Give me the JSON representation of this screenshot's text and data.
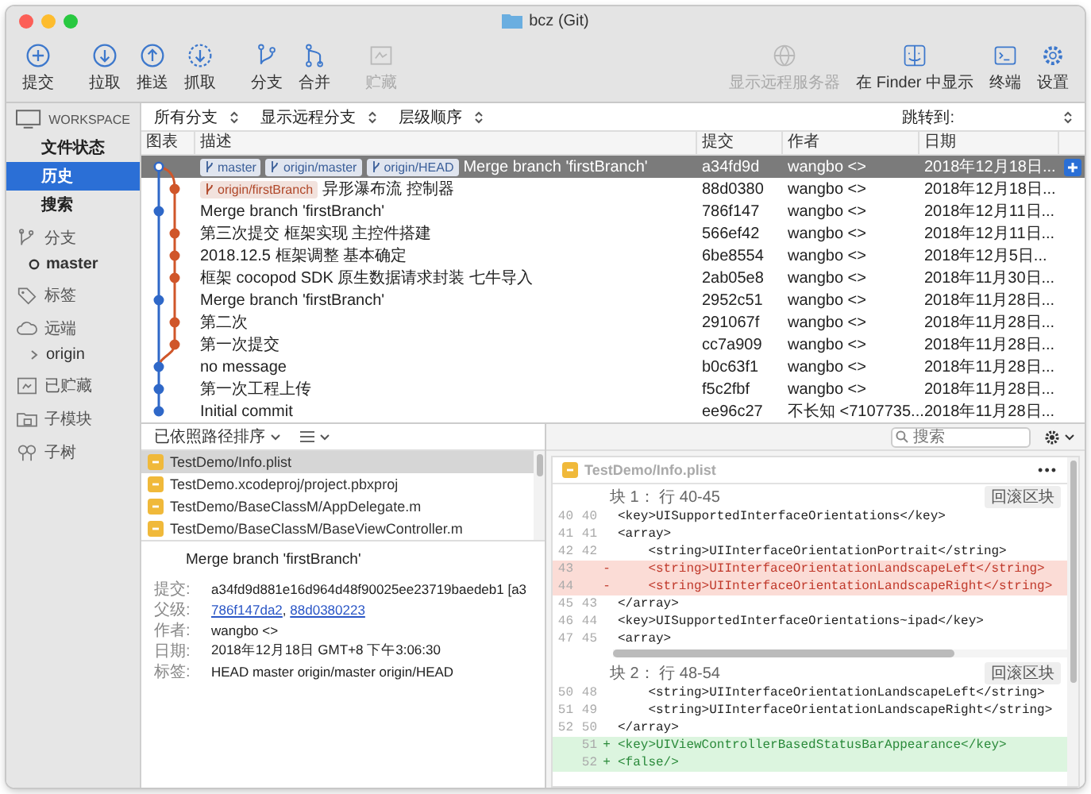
{
  "window": {
    "title": "bcz (Git)"
  },
  "toolbar": {
    "groups": [
      [
        {
          "label": "提交",
          "disabled": false
        }
      ],
      [
        {
          "label": "拉取",
          "disabled": false
        },
        {
          "label": "推送",
          "disabled": false
        },
        {
          "label": "抓取",
          "disabled": false
        }
      ],
      [
        {
          "label": "分支",
          "disabled": false
        },
        {
          "label": "合并",
          "disabled": false
        }
      ],
      [
        {
          "label": "贮藏",
          "disabled": true
        }
      ]
    ],
    "right": [
      {
        "label": "显示远程服务器",
        "disabled": true
      },
      {
        "label": "在 Finder 中显示",
        "disabled": false
      },
      {
        "label": "终端",
        "disabled": false
      },
      {
        "label": "设置",
        "disabled": false
      }
    ]
  },
  "sidebar": {
    "workspace_label": "WORKSPACE",
    "views": [
      {
        "label": "文件状态",
        "selected": false
      },
      {
        "label": "历史",
        "selected": true
      },
      {
        "label": "搜索",
        "selected": false
      }
    ],
    "sections": [
      {
        "label": "分支",
        "children": [
          {
            "label": "master",
            "kind": "branch",
            "current": true
          }
        ]
      },
      {
        "label": "标签"
      },
      {
        "label": "远端",
        "children": [
          {
            "label": "origin",
            "kind": "remote",
            "current": false
          }
        ]
      },
      {
        "label": "已贮藏"
      },
      {
        "label": "子模块"
      },
      {
        "label": "子树"
      }
    ]
  },
  "filters": {
    "selects": [
      "所有分支",
      "显示远程分支",
      "层级顺序"
    ],
    "jump_label": "跳转到:"
  },
  "table": {
    "columns": [
      "图表",
      "描述",
      "提交",
      "作者",
      "日期"
    ],
    "rows": [
      {
        "refs": [
          {
            "name": "master",
            "color": "#3b5f99"
          },
          {
            "name": "origin/master",
            "color": "#3b5f99"
          },
          {
            "name": "origin/HEAD",
            "color": "#3b5f99"
          }
        ],
        "message": "Merge branch 'firstBranch'",
        "hash": "a34fd9d",
        "author": "wangbo <>",
        "date": "2018年12月18日...",
        "color": "#2f68c8",
        "current": true,
        "selected": true
      },
      {
        "refs": [
          {
            "name": "origin/firstBranch",
            "color": "#b0482a"
          }
        ],
        "message": "异形瀑布流  控制器",
        "hash": "88d0380",
        "author": "wangbo <>",
        "date": "2018年12月18日...",
        "color": "#d0562a",
        "current": false,
        "selected": false
      },
      {
        "refs": [],
        "message": "Merge branch 'firstBranch'",
        "hash": "786f147",
        "author": "wangbo <>",
        "date": "2018年12月11日...",
        "color": "#2f68c8",
        "current": false,
        "selected": false
      },
      {
        "refs": [],
        "message": "第三次提交  框架实现  主控件搭建",
        "hash": "566ef42",
        "author": "wangbo <>",
        "date": "2018年12月11日...",
        "color": "#d0562a",
        "current": false,
        "selected": false
      },
      {
        "refs": [],
        "message": "2018.12.5  框架调整  基本确定",
        "hash": "6be8554",
        "author": "wangbo <>",
        "date": "2018年12月5日...",
        "color": "#d0562a",
        "current": false,
        "selected": false
      },
      {
        "refs": [],
        "message": "框架  cocopod   SDK  原生数据请求封装  七牛导入",
        "hash": "2ab05e8",
        "author": "wangbo <>",
        "date": "2018年11月30日...",
        "color": "#d0562a",
        "current": false,
        "selected": false
      },
      {
        "refs": [],
        "message": "Merge branch 'firstBranch'",
        "hash": "2952c51",
        "author": "wangbo <>",
        "date": "2018年11月28日...",
        "color": "#2f68c8",
        "current": false,
        "selected": false
      },
      {
        "refs": [],
        "message": "第二次",
        "hash": "291067f",
        "author": "wangbo <>",
        "date": "2018年11月28日...",
        "color": "#d0562a",
        "current": false,
        "selected": false
      },
      {
        "refs": [],
        "message": "第一次提交",
        "hash": "cc7a909",
        "author": "wangbo <>",
        "date": "2018年11月28日...",
        "color": "#d0562a",
        "current": false,
        "selected": false
      },
      {
        "refs": [],
        "message": "no message",
        "hash": "b0c63f1",
        "author": "wangbo <>",
        "date": "2018年11月28日...",
        "color": "#2f68c8",
        "current": false,
        "selected": false
      },
      {
        "refs": [],
        "message": "第一次工程上传",
        "hash": "f5c2fbf",
        "author": "wangbo <>",
        "date": "2018年11月28日...",
        "color": "#2f68c8",
        "current": false,
        "selected": false
      },
      {
        "refs": [],
        "message": "Initial commit",
        "hash": "ee96c27",
        "author": "不长知 <7107735...",
        "date": "2018年11月28日...",
        "color": "#2f68c8",
        "current": false,
        "selected": false
      }
    ]
  },
  "files": {
    "sort_label": "已依照路径排序",
    "items": [
      {
        "path": "TestDemo/Info.plist",
        "selected": true
      },
      {
        "path": "TestDemo.xcodeproj/project.pbxproj",
        "selected": false
      },
      {
        "path": "TestDemo/BaseClassM/AppDelegate.m",
        "selected": false
      },
      {
        "path": "TestDemo/BaseClassM/BaseViewController.m",
        "selected": false
      }
    ]
  },
  "commit_detail": {
    "message": "Merge branch 'firstBranch'",
    "fields": [
      {
        "label": "提交:",
        "kind": "text",
        "value": "a34fd9d881e16d964d48f90025ee23719baedeb1 [a3"
      },
      {
        "label": "父级:",
        "kind": "links",
        "links": [
          "786f147da2",
          "88d0380223"
        ],
        "separator": ", "
      },
      {
        "label": "作者:",
        "kind": "text",
        "value": "wangbo <>"
      },
      {
        "label": "日期:",
        "kind": "text",
        "value": "2018年12月18日 GMT+8 下午3:06:30"
      },
      {
        "label": "标签:",
        "kind": "text",
        "value": "HEAD master origin/master origin/HEAD"
      }
    ]
  },
  "diff": {
    "search_placeholder": "搜索",
    "file": "TestDemo/Info.plist",
    "more": "•••",
    "hunks": [
      {
        "title": "块 1： 行 40-45",
        "action": "回滚区块",
        "lines": [
          {
            "old": "40",
            "new": "40",
            "kind": "context",
            "text": "<key>UISupportedInterfaceOrientations</key>"
          },
          {
            "old": "41",
            "new": "41",
            "kind": "context",
            "text": "<array>"
          },
          {
            "old": "42",
            "new": "42",
            "kind": "context",
            "text": "    <string>UIInterfaceOrientationPortrait</string>"
          },
          {
            "old": "43",
            "kind": "removed",
            "sign": "-",
            "text": "    <string>UIInterfaceOrientationLandscapeLeft</string>"
          },
          {
            "old": "44",
            "kind": "removed",
            "sign": "-",
            "text": "    <string>UIInterfaceOrientationLandscapeRight</string>"
          },
          {
            "old": "45",
            "new": "43",
            "kind": "context",
            "text": "</array>"
          },
          {
            "old": "46",
            "new": "44",
            "kind": "context",
            "text": "<key>UISupportedInterfaceOrientations~ipad</key>"
          },
          {
            "old": "47",
            "new": "45",
            "kind": "context",
            "text": "<array>"
          }
        ]
      },
      {
        "title": "块 2： 行 48-54",
        "action": "回滚区块",
        "lines": [
          {
            "old": "50",
            "new": "48",
            "kind": "context",
            "text": "    <string>UIInterfaceOrientationLandscapeLeft</string>"
          },
          {
            "old": "51",
            "new": "49",
            "kind": "context",
            "text": "    <string>UIInterfaceOrientationLandscapeRight</string>"
          },
          {
            "old": "52",
            "new": "50",
            "kind": "context",
            "text": "</array>"
          },
          {
            "new": "51",
            "kind": "added",
            "sign": "+",
            "text": "<key>UIViewControllerBasedStatusBarAppearance</key>"
          },
          {
            "new": "52",
            "kind": "added",
            "sign": "+",
            "text": "<false/>"
          }
        ]
      }
    ]
  }
}
